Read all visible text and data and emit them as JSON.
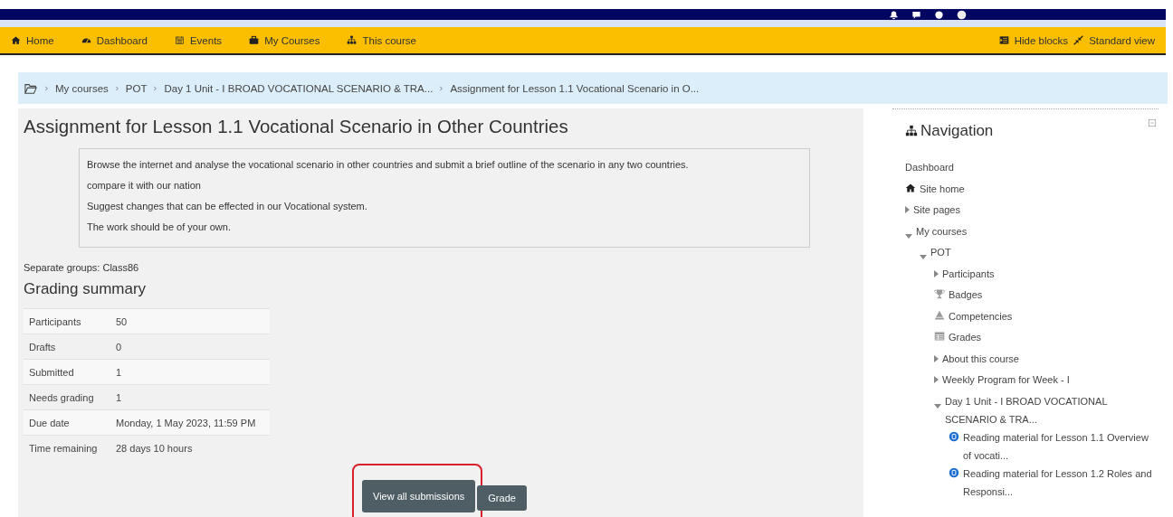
{
  "nav_bar": {
    "items": [
      {
        "label": "Home"
      },
      {
        "label": "Dashboard"
      },
      {
        "label": "Events"
      },
      {
        "label": "My Courses"
      },
      {
        "label": "This course"
      }
    ],
    "right_items": [
      {
        "label": "Hide blocks"
      },
      {
        "label": "Standard view"
      }
    ]
  },
  "breadcrumb": [
    "My courses",
    "POT",
    "Day 1 Unit - I BROAD VOCATIONAL SCENARIO & TRA...",
    "Assignment for Lesson 1.1 Vocational Scenario in O..."
  ],
  "page_title": "Assignment for Lesson 1.1 Vocational Scenario in Other Countries",
  "description": [
    "Browse the internet and analyse the vocational scenario in other countries and submit a brief outline of the scenario in any two countries.",
    "compare it with our nation",
    "Suggest changes that can be effected in our Vocational system.",
    "The  work should be of your own."
  ],
  "groups_label": "Separate groups: Class86",
  "grading_summary": {
    "title": "Grading summary",
    "rows": [
      {
        "label": "Participants",
        "value": "50"
      },
      {
        "label": "Drafts",
        "value": "0"
      },
      {
        "label": "Submitted",
        "value": "1"
      },
      {
        "label": "Needs grading",
        "value": "1"
      },
      {
        "label": "Due date",
        "value": "Monday, 1 May 2023, 11:59 PM"
      },
      {
        "label": "Time remaining",
        "value": "28 days 10 hours"
      }
    ]
  },
  "buttons": [
    {
      "label": "View all submissions",
      "highlighted": true
    },
    {
      "label": "Grade",
      "highlighted": false
    }
  ],
  "navigation_block": {
    "title": "Navigation",
    "items": [
      {
        "label": "Dashboard",
        "kind": "plain"
      },
      {
        "label": "Site home",
        "kind": "home"
      },
      {
        "label": "Site pages",
        "kind": "branch",
        "expanded": false
      },
      {
        "label": "My courses",
        "kind": "branch",
        "expanded": true,
        "children": [
          {
            "label": "POT",
            "kind": "branch",
            "expanded": true,
            "children": [
              {
                "label": "Participants",
                "kind": "branch",
                "expanded": false
              },
              {
                "label": "Badges",
                "kind": "trophy"
              },
              {
                "label": "Competencies",
                "kind": "competency"
              },
              {
                "label": "Grades",
                "kind": "table"
              },
              {
                "label": "About this course",
                "kind": "branch",
                "expanded": false
              },
              {
                "label": "Weekly Program for Week - I",
                "kind": "branch",
                "expanded": false
              },
              {
                "label": "Day 1 Unit - I BROAD VOCATIONAL SCENARIO & TRA...",
                "kind": "branch",
                "expanded": true,
                "children": [
                  {
                    "label": "Reading material for Lesson 1.1 Overview of vocati...",
                    "kind": "resource"
                  },
                  {
                    "label": "Reading material for Lesson 1.2 Roles and Responsi...",
                    "kind": "resource"
                  }
                ]
              }
            ]
          }
        ]
      }
    ]
  }
}
